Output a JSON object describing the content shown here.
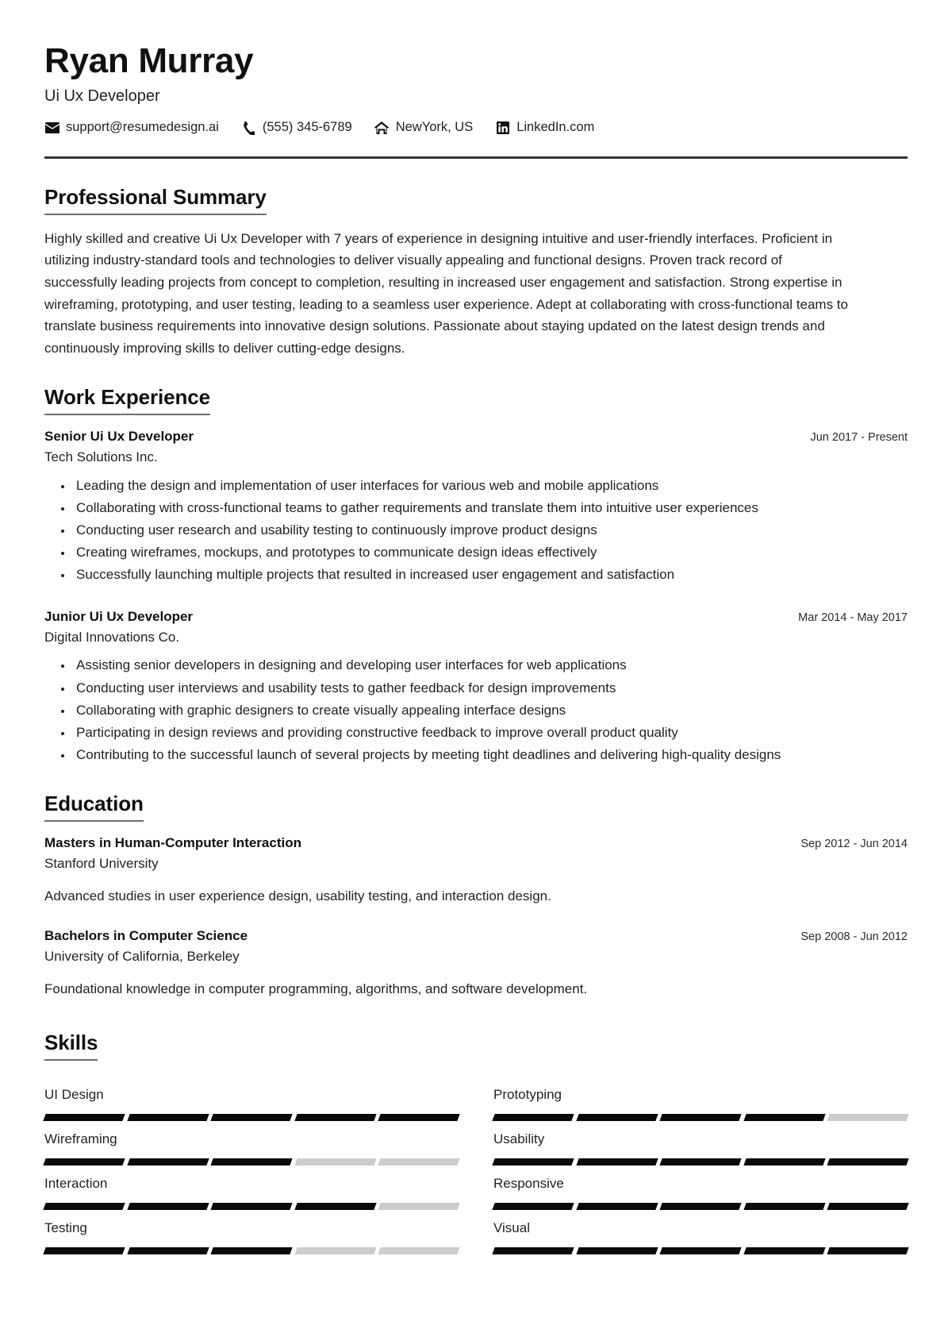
{
  "header": {
    "name": "Ryan Murray",
    "job_title": "Ui Ux Developer",
    "contacts": [
      {
        "icon": "email-icon",
        "text": "support@resumedesign.ai"
      },
      {
        "icon": "phone-icon",
        "text": "(555) 345-6789"
      },
      {
        "icon": "home-icon",
        "text": "NewYork, US"
      },
      {
        "icon": "linkedin-icon",
        "text": "LinkedIn.com"
      }
    ]
  },
  "summary": {
    "heading": "Professional Summary",
    "text": "Highly skilled and creative Ui Ux Developer with 7 years of experience in designing intuitive and user-friendly interfaces. Proficient in utilizing industry-standard tools and technologies to deliver visually appealing and functional designs. Proven track record of successfully leading projects from concept to completion, resulting in increased user engagement and satisfaction. Strong expertise in wireframing, prototyping, and user testing, leading to a seamless user experience. Adept at collaborating with cross-functional teams to translate business requirements into innovative design solutions. Passionate about staying updated on the latest design trends and continuously improving skills to deliver cutting-edge designs."
  },
  "experience": {
    "heading": "Work Experience",
    "entries": [
      {
        "role": "Senior Ui Ux Developer",
        "dates": "Jun 2017 - Present",
        "organization": "Tech Solutions Inc.",
        "bullets": [
          "Leading the design and implementation of user interfaces for various web and mobile applications",
          "Collaborating with cross-functional teams to gather requirements and translate them into intuitive user experiences",
          "Conducting user research and usability testing to continuously improve product designs",
          "Creating wireframes, mockups, and prototypes to communicate design ideas effectively",
          "Successfully launching multiple projects that resulted in increased user engagement and satisfaction"
        ]
      },
      {
        "role": "Junior Ui Ux Developer",
        "dates": "Mar 2014 - May 2017",
        "organization": "Digital Innovations Co.",
        "bullets": [
          "Assisting senior developers in designing and developing user interfaces for web applications",
          "Conducting user interviews and usability tests to gather feedback for design improvements",
          "Collaborating with graphic designers to create visually appealing interface designs",
          "Participating in design reviews and providing constructive feedback to improve overall product quality",
          "Contributing to the successful launch of several projects by meeting tight deadlines and delivering high-quality designs"
        ]
      }
    ]
  },
  "education": {
    "heading": "Education",
    "entries": [
      {
        "degree": "Masters in Human-Computer Interaction",
        "dates": "Sep 2012 - Jun 2014",
        "school": "Stanford University",
        "description": "Advanced studies in user experience design, usability testing, and interaction design."
      },
      {
        "degree": "Bachelors in Computer Science",
        "dates": "Sep 2008 - Jun 2012",
        "school": "University of California, Berkeley",
        "description": "Foundational knowledge in computer programming, algorithms, and software development."
      }
    ]
  },
  "skills": {
    "heading": "Skills",
    "total_segments": 5,
    "items": [
      {
        "name": "UI Design",
        "level": 5
      },
      {
        "name": "Prototyping",
        "level": 4
      },
      {
        "name": "Wireframing",
        "level": 3
      },
      {
        "name": "Usability",
        "level": 5
      },
      {
        "name": "Interaction",
        "level": 4
      },
      {
        "name": "Responsive",
        "level": 5
      },
      {
        "name": "Testing",
        "level": 3
      },
      {
        "name": "Visual",
        "level": 5
      }
    ]
  },
  "colors": {
    "text": "#222222",
    "heading": "#111111",
    "rule": "#333333",
    "heading_underline": "#6e6e6e",
    "skill_filled": "#0a0a0a",
    "skill_empty": "#cccccc"
  }
}
